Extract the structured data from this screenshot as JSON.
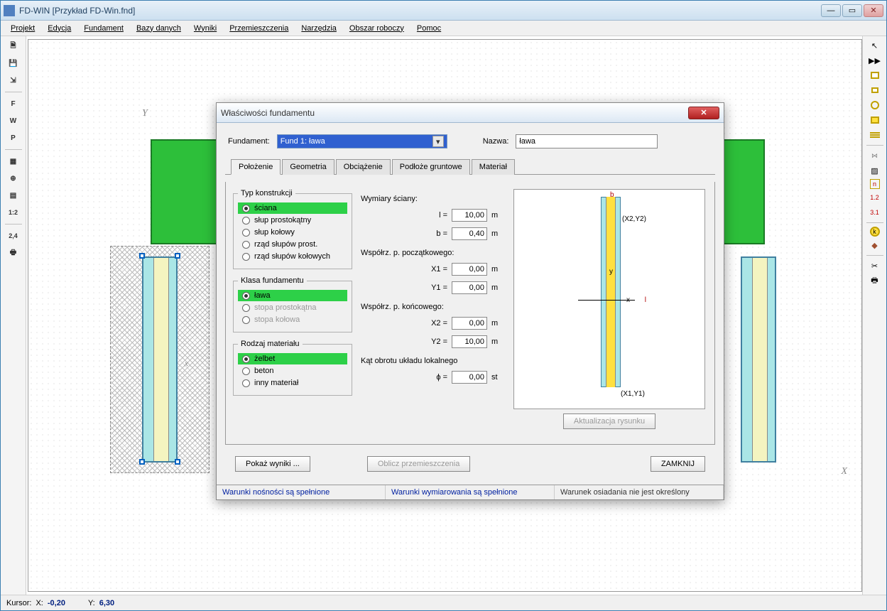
{
  "window": {
    "title": "FD-WIN [Przykład FD-Win.fnd]"
  },
  "menu": [
    "Projekt",
    "Edycja",
    "Fundament",
    "Bazy danych",
    "Wyniki",
    "Przemieszczenia",
    "Narzędzia",
    "Obszar roboczy",
    "Pomoc"
  ],
  "left_toolbar": [
    "F",
    "W",
    "P",
    "1:2",
    "2,4"
  ],
  "right_toolbar_text": {
    "ratio": "1.2",
    "dim": "3.1",
    "k": "k",
    "n": "n"
  },
  "canvas": {
    "y_label": "Y",
    "x_label": "X",
    "local_x": "x"
  },
  "statusbar": {
    "cursor_label": "Kursor:",
    "x_label": "X:",
    "x_val": "-0,20",
    "y_label": "Y:",
    "y_val": "6,30"
  },
  "dialog": {
    "title": "Właściwości fundamentu",
    "fund_label": "Fundament:",
    "fund_combo": "Fund 1: ława",
    "name_label": "Nazwa:",
    "name_value": "ława",
    "tabs": [
      "Położenie",
      "Geometria",
      "Obciążenie",
      "Podłoże gruntowe",
      "Materiał"
    ],
    "groups": {
      "typ": {
        "legend": "Typ konstrukcji",
        "opts": [
          "ściana",
          "słup prostokątny",
          "słup kołowy",
          "rząd słupów prost.",
          "rząd słupów kołowych"
        ]
      },
      "klasa": {
        "legend": "Klasa fundamentu",
        "opts": [
          "ława",
          "stopa prostokątna",
          "stopa kołowa"
        ]
      },
      "material": {
        "legend": "Rodzaj materiału",
        "opts": [
          "żelbet",
          "beton",
          "inny materiał"
        ]
      }
    },
    "dims": {
      "wall_label": "Wymiary ściany:",
      "l_label": "l =",
      "l_val": "10,00",
      "l_unit": "m",
      "b_label": "b =",
      "b_val": "0,40",
      "b_unit": "m",
      "start_label": "Współrz. p. początkowego:",
      "x1_label": "X1 =",
      "x1_val": "0,00",
      "x1_unit": "m",
      "y1_label": "Y1 =",
      "y1_val": "0,00",
      "y1_unit": "m",
      "end_label": "Współrz. p. końcowego:",
      "x2_label": "X2 =",
      "x2_val": "0,00",
      "x2_unit": "m",
      "y2_label": "Y2 =",
      "y2_val": "10,00",
      "y2_unit": "m",
      "rot_label": "Kąt obrotu układu lokalnego",
      "phi_label": "ϕ =",
      "phi_val": "0,00",
      "phi_unit": "st"
    },
    "preview": {
      "b_lbl": "b",
      "l_lbl": "l",
      "x_lbl": "x",
      "y_lbl": "y",
      "p1": "(X1,Y1)",
      "p2": "(X2,Y2)"
    },
    "buttons": {
      "update": "Aktualizacja rysunku",
      "show": "Pokaż wyniki ...",
      "calc": "Oblicz przemieszczenia",
      "close": "ZAMKNIJ"
    },
    "status": {
      "load": "Warunki nośności są spełnione",
      "dim": "Warunki wymiarowania są spełnione",
      "settle": "Warunek osiadania nie jest określony"
    }
  }
}
